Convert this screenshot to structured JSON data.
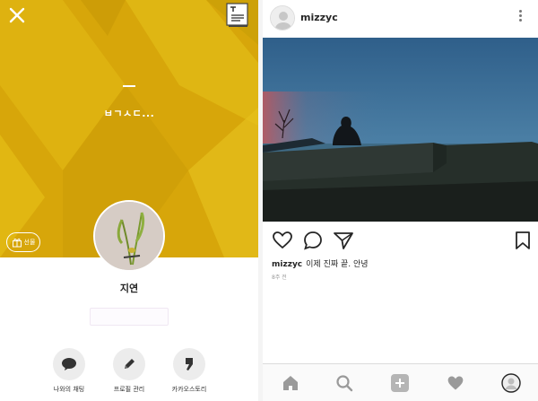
{
  "profile": {
    "status_message": "ㅂㄱㅅㄷ...",
    "name": "지연",
    "gift_label": "선물",
    "actions": [
      {
        "label": "나와의 채팅",
        "icon": "speech-bubble-icon"
      },
      {
        "label": "프로필 관리",
        "icon": "pencil-icon"
      },
      {
        "label": "카카오스토리",
        "icon": "kakaostory-icon"
      }
    ],
    "colors": {
      "cover": "#d7a60a",
      "cover_light": "#e3bd17",
      "cover_dark": "#c99a06"
    }
  },
  "post": {
    "username": "mizzyc",
    "caption_user": "mizzyc",
    "caption_text": "이제 진짜 끝. 안녕",
    "time": "8주 전",
    "icons": {
      "like": "heart-outline-icon",
      "comment": "comment-bubble-icon",
      "share": "paper-plane-icon",
      "save": "bookmark-icon",
      "more": "vertical-dots-icon"
    },
    "tabs": [
      "home-icon",
      "search-icon",
      "add-post-icon",
      "heart-icon",
      "profile-icon"
    ]
  }
}
